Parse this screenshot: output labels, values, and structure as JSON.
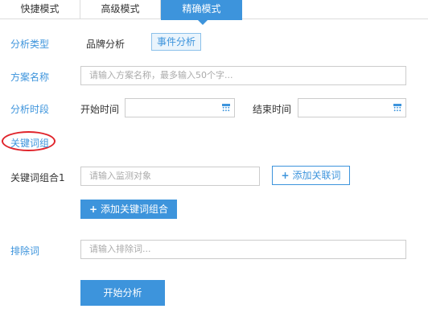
{
  "tabs": [
    {
      "label": "快捷模式"
    },
    {
      "label": "高级模式"
    },
    {
      "label": "精确模式"
    }
  ],
  "form": {
    "analysis_type": {
      "label": "分析类型",
      "options": [
        "品牌分析",
        "事件分析"
      ],
      "selected": "事件分析"
    },
    "plan_name": {
      "label": "方案名称",
      "placeholder": "请输入方案名称，最多输入50个字..."
    },
    "period": {
      "label": "分析时段",
      "start_label": "开始时间",
      "end_label": "结束时间"
    },
    "keyword_group": {
      "label": "关键词组"
    },
    "keyword_combo": {
      "label": "关键词组合1",
      "placeholder": "请输入监测对象",
      "add_related": "添加关联词"
    },
    "add_combo": "添加关键词组合",
    "exclude": {
      "label": "排除词",
      "placeholder": "请输入排除词..."
    },
    "submit": "开始分析"
  },
  "colors": {
    "accent": "#3d94dc",
    "highlight": "#e0242b"
  },
  "icons": {
    "calendar": "calendar-icon",
    "plus": "plus-icon"
  }
}
